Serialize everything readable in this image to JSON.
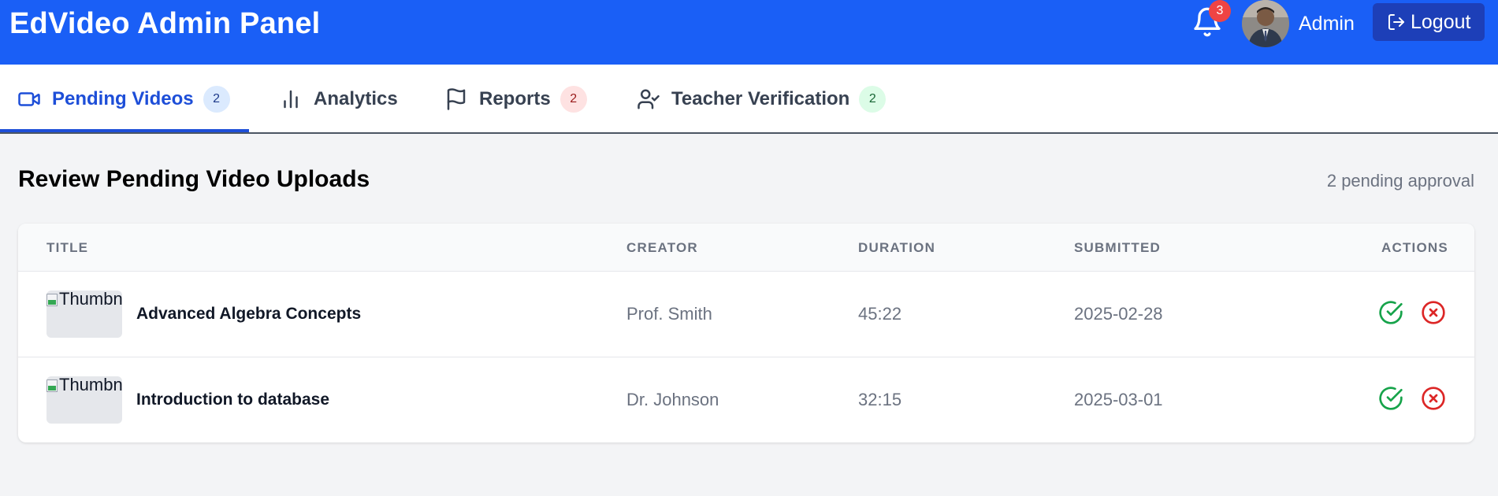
{
  "app": {
    "title": "EdVideo Admin Panel"
  },
  "header": {
    "notifications_count": "3",
    "user_name": "Admin",
    "logout_label": "Logout"
  },
  "tabs": [
    {
      "label": "Pending Videos",
      "count": "2",
      "icon": "video-icon",
      "active": true,
      "count_bg": "#dbeafe",
      "count_color": "#1e3a8a"
    },
    {
      "label": "Analytics",
      "count": "",
      "icon": "bar-chart-icon",
      "active": false
    },
    {
      "label": "Reports",
      "count": "2",
      "icon": "flag-icon",
      "active": false,
      "count_bg": "#fee2e2",
      "count_color": "#991b1b"
    },
    {
      "label": "Teacher Verification",
      "count": "2",
      "icon": "user-check-icon",
      "active": false,
      "count_bg": "#dcfce7",
      "count_color": "#166534"
    }
  ],
  "main": {
    "title": "Review Pending Video Uploads",
    "pending_text": "2 pending approval"
  },
  "table": {
    "columns": [
      "TITLE",
      "CREATOR",
      "DURATION",
      "SUBMITTED",
      "ACTIONS"
    ],
    "rows": [
      {
        "thumb_alt": "Thumbnail",
        "title": "Advanced Algebra Concepts",
        "creator": "Prof. Smith",
        "duration": "45:22",
        "submitted": "2025-02-28"
      },
      {
        "thumb_alt": "Thumbnail",
        "title": "Introduction to database",
        "creator": "Dr. Johnson",
        "duration": "32:15",
        "submitted": "2025-03-01"
      }
    ]
  },
  "colors": {
    "header_bg": "#1a5ff6",
    "logout_bg": "#1d3fb8",
    "active_tab": "#1d4ed8",
    "approve": "#16a34a",
    "reject": "#dc2626",
    "badge": "#ef4444"
  }
}
